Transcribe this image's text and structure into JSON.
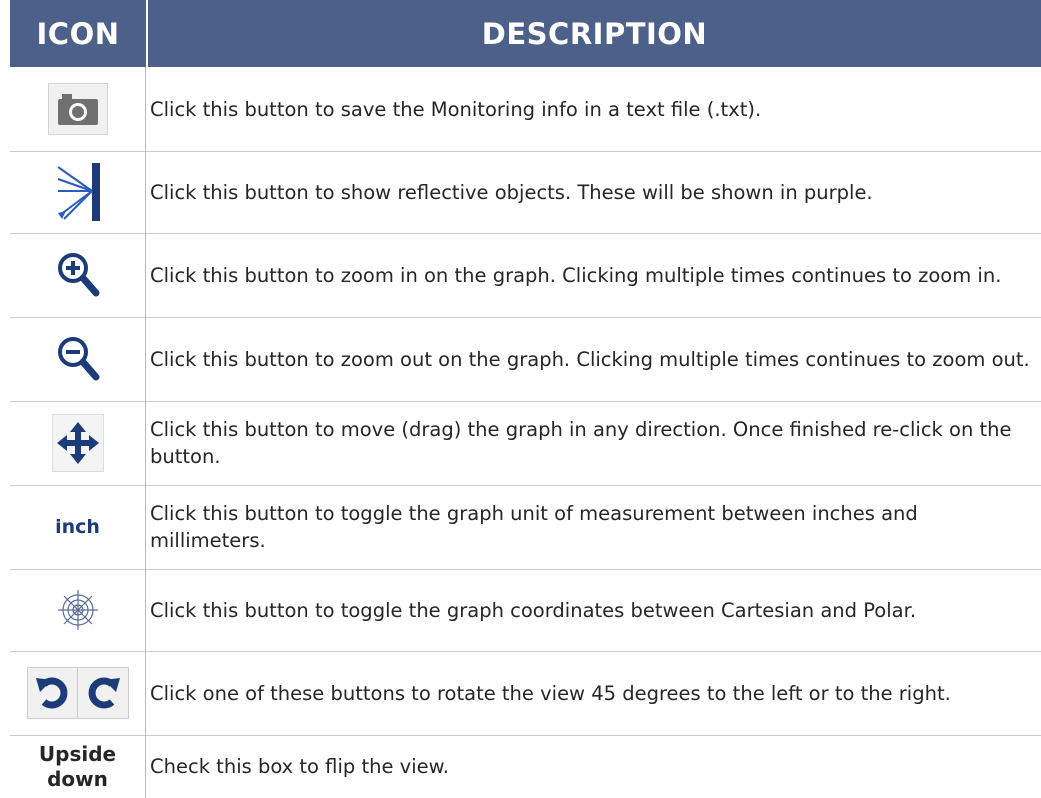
{
  "header": {
    "icon_col": "ICON",
    "desc_col": "DESCRIPTION"
  },
  "rows": [
    {
      "icon": "camera-icon",
      "description": "Click this button to save the Monitoring info in a text file (.txt)."
    },
    {
      "icon": "reflective-objects-icon",
      "description": "Click this button to show reflective objects. These will be shown in purple."
    },
    {
      "icon": "zoom-in-icon",
      "description": "Click this button to zoom in on the graph. Clicking multiple times continues to zoom in."
    },
    {
      "icon": "zoom-out-icon",
      "description": "Click this button to zoom out on the graph. Clicking multiple times continues to zoom out."
    },
    {
      "icon": "move-icon",
      "description": "Click this button to move (drag) the graph in any direction. Once finished re-click on the button."
    },
    {
      "icon": "unit-toggle-icon",
      "icon_text": "inch",
      "description": "Click this button to toggle the graph unit of measurement between inches and millimeters."
    },
    {
      "icon": "polar-grid-icon",
      "description": "Click this button to toggle the graph coordinates between Cartesian and Polar."
    },
    {
      "icon": "rotate-icons",
      "description": "Click one of these buttons to rotate the view 45 degrees to the left or to the right."
    },
    {
      "icon": "upside-down-label",
      "icon_text": "Upside down",
      "description": "Check this box to flip the view."
    }
  ],
  "colors": {
    "header_bg": "#4d6089",
    "icon_blue": "#1d3b78"
  }
}
